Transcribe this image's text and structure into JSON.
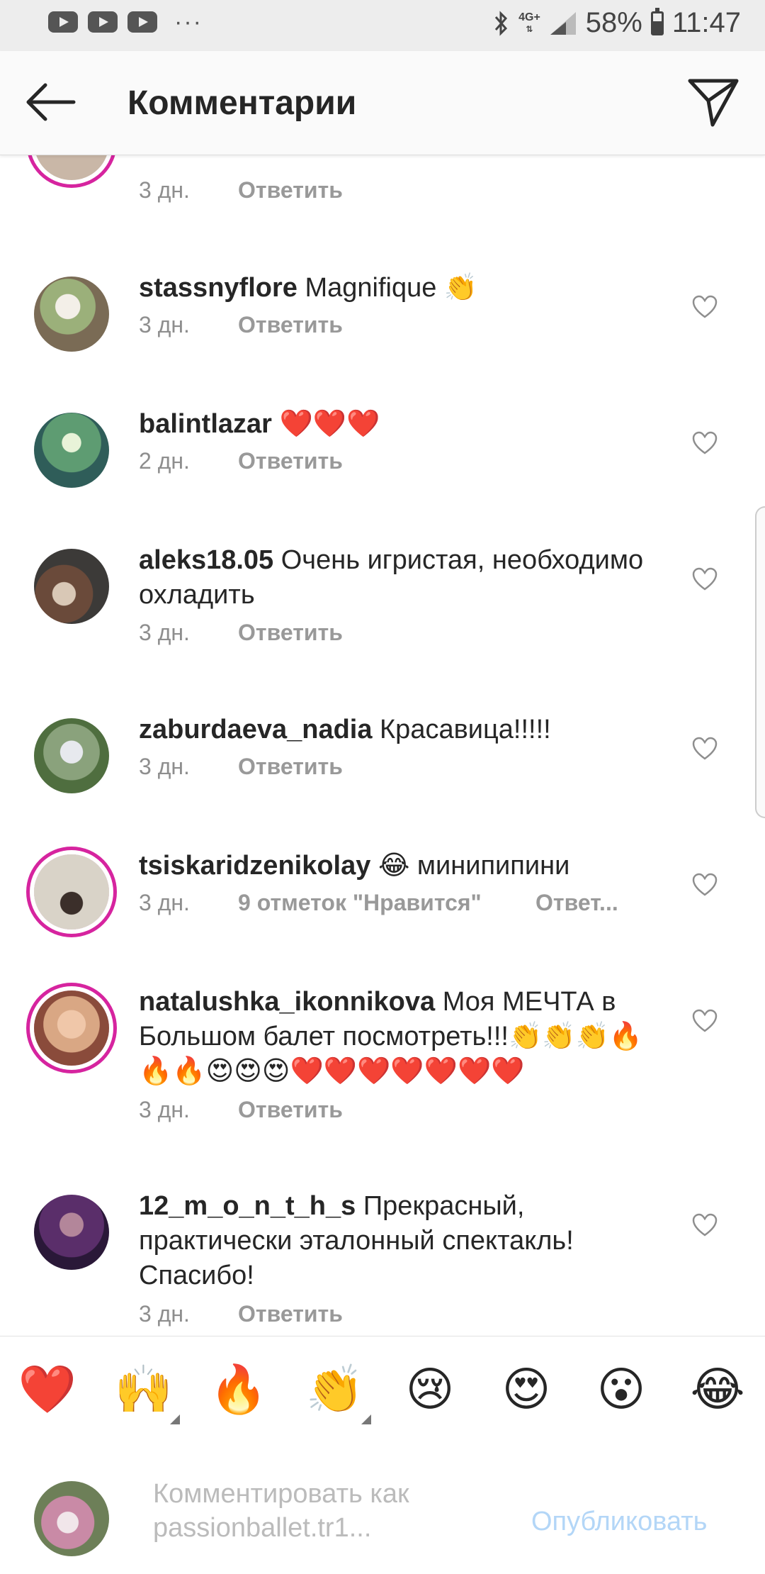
{
  "status_bar": {
    "left_icons": [
      "youtube-icon",
      "youtube-icon",
      "youtube-icon"
    ],
    "more": "···",
    "network": "4G+",
    "battery": "58%",
    "time": "11:47",
    "battery_level": 0.58
  },
  "header": {
    "title": "Комментарии",
    "back_icon": "arrow-left-icon",
    "share_icon": "paper-plane-icon"
  },
  "top_partial": {
    "time": "3 дн.",
    "reply": "Ответить"
  },
  "comments": [
    {
      "username": "stassnyflore",
      "text": "Magnifique 👏",
      "time": "3 дн.",
      "reply": "Ответить"
    },
    {
      "username": "balintlazar",
      "text": "❤️❤️❤️",
      "time": "2 дн.",
      "reply": "Ответить"
    },
    {
      "username": "aleks18.05",
      "text": "Очень игристая, необходимо охладить",
      "time": "3 дн.",
      "reply": "Ответить"
    },
    {
      "username": "zaburdaeva_nadia",
      "text": "Красавица!!!!!",
      "time": "3 дн.",
      "reply": "Ответить"
    },
    {
      "username": "tsiskaridzenikolay",
      "text": "😂 минипипини",
      "time": "3 дн.",
      "likes": "9 отметок \"Нравится\"",
      "reply": "Ответ..."
    },
    {
      "username": "natalushka_ikonnikova",
      "text": "Моя МЕЧТА в Большом балет посмотреть!!!👏👏👏🔥🔥🔥😍😍😍❤️❤️❤️❤️❤️❤️❤️",
      "time": "3 дн.",
      "reply": "Ответить"
    },
    {
      "username": "12_m_o_n_t_h_s",
      "text": "Прекрасный, практически эталонный спектакль! Спасибо!",
      "time": "3 дн.",
      "reply": "Ответить"
    }
  ],
  "emoji_bar": [
    "❤️",
    "🙌",
    "🔥",
    "👏",
    "😢",
    "😍",
    "😮",
    "😂"
  ],
  "input": {
    "placeholder_line1": "Комментировать как",
    "placeholder_line2": "passionballet.tr1...",
    "publish": "Опубликовать"
  },
  "colors": {
    "accent_disabled": "#b3d6f7",
    "story_ring": "#d6249f",
    "muted_text": "#8e8e8e"
  }
}
